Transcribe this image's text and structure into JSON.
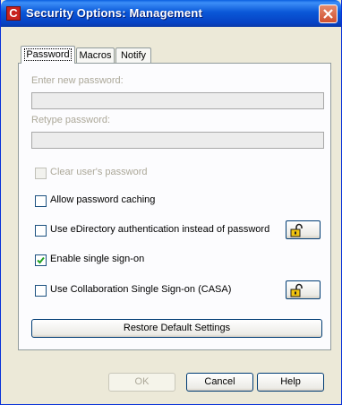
{
  "window": {
    "title": "Security Options:  Management",
    "app_icon_letter": "C"
  },
  "tabs": [
    {
      "label": "Password",
      "active": true
    },
    {
      "label": "Macros",
      "active": false
    },
    {
      "label": "Notify",
      "active": false
    }
  ],
  "fields": {
    "new_password_label": "Enter new password:",
    "new_password_value": "",
    "retype_password_label": "Retype password:",
    "retype_password_value": ""
  },
  "checkboxes": [
    {
      "label": "Clear user's password",
      "checked": false,
      "enabled": false
    },
    {
      "label": "Allow password caching",
      "checked": false,
      "enabled": true
    },
    {
      "label": "Use eDirectory authentication instead of password",
      "checked": false,
      "enabled": true
    },
    {
      "label": "Enable single sign-on",
      "checked": true,
      "enabled": true
    },
    {
      "label": "Use Collaboration Single Sign-on (CASA)",
      "checked": false,
      "enabled": true
    }
  ],
  "restore_button": "Restore Default Settings",
  "buttons": {
    "ok": "OK",
    "cancel": "Cancel",
    "help": "Help"
  },
  "colors": {
    "titlebar": "#0a58d8",
    "dialog_bg": "#ece9d8",
    "disabled_text": "#aca899",
    "checkmark": "#21a121",
    "close_button": "#d0502f",
    "lock": "#f1c40f"
  }
}
